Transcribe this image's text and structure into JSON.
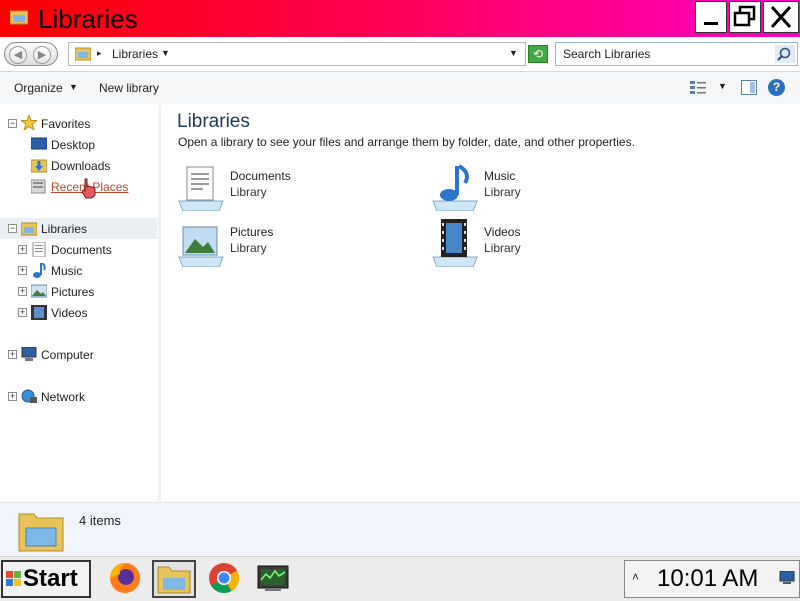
{
  "window": {
    "title": "Libraries",
    "controls": {
      "minimize": "minimize",
      "maximize": "restore",
      "close": "close"
    }
  },
  "address": {
    "path": "Libraries",
    "search_placeholder": "Search Libraries"
  },
  "toolbar": {
    "organize_label": "Organize",
    "new_library_label": "New library"
  },
  "navigation": {
    "favorites": {
      "label": "Favorites",
      "items": [
        {
          "label": "Desktop",
          "icon": "desktop-icon"
        },
        {
          "label": "Downloads",
          "icon": "downloads-icon"
        },
        {
          "label": "Recent Places",
          "icon": "recent-places-icon"
        }
      ]
    },
    "libraries": {
      "label": "Libraries",
      "items": [
        {
          "label": "Documents",
          "icon": "documents-icon"
        },
        {
          "label": "Music",
          "icon": "music-icon"
        },
        {
          "label": "Pictures",
          "icon": "pictures-icon"
        },
        {
          "label": "Videos",
          "icon": "videos-icon"
        }
      ]
    },
    "computer_label": "Computer",
    "network_label": "Network"
  },
  "content": {
    "heading": "Libraries",
    "description": "Open a library to see your files and arrange them by folder, date, and other properties.",
    "libraries": [
      {
        "name": "Documents",
        "type": "Library",
        "icon": "documents-library-icon"
      },
      {
        "name": "Music",
        "type": "Library",
        "icon": "music-library-icon"
      },
      {
        "name": "Pictures",
        "type": "Library",
        "icon": "pictures-library-icon"
      },
      {
        "name": "Videos",
        "type": "Library",
        "icon": "videos-library-icon"
      }
    ]
  },
  "details": {
    "item_count": "4 items"
  },
  "taskbar": {
    "start_label": "Start",
    "apps": [
      "firefox-icon",
      "file-explorer-icon",
      "chrome-icon",
      "task-manager-icon"
    ],
    "clock": "10:01 AM"
  },
  "colors": {
    "titlebar_gradient_start": "#ff0000",
    "titlebar_gradient_end": "#ff00c8",
    "heading_blue": "#1e395b",
    "link_hover": "#b5452b"
  }
}
